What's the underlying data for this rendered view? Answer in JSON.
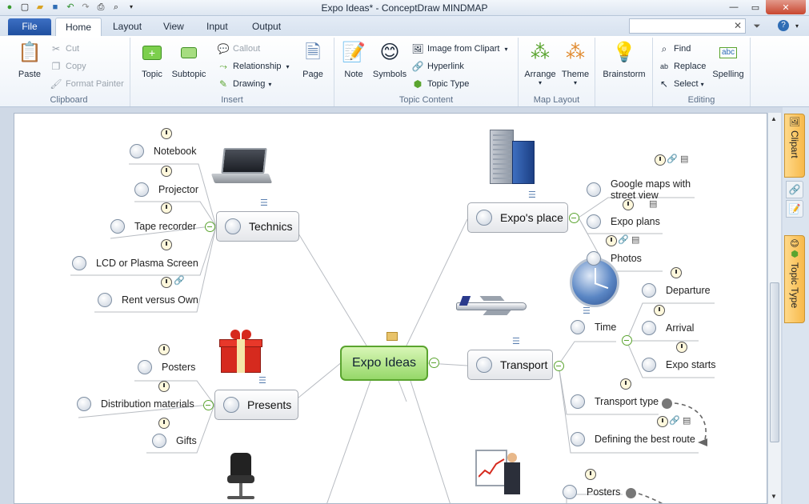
{
  "window": {
    "title": "Expo Ideas* - ConceptDraw MINDMAP"
  },
  "tabs": {
    "file": "File",
    "home": "Home",
    "layout": "Layout",
    "view": "View",
    "input": "Input",
    "output": "Output"
  },
  "ribbon": {
    "clipboard": {
      "label": "Clipboard",
      "paste": "Paste",
      "cut": "Cut",
      "copy": "Copy",
      "format_painter": "Format Painter"
    },
    "insert": {
      "label": "Insert",
      "topic": "Topic",
      "subtopic": "Subtopic",
      "callout": "Callout",
      "relationship": "Relationship",
      "drawing": "Drawing",
      "page": "Page"
    },
    "topic_content": {
      "label": "Topic Content",
      "note": "Note",
      "symbols": "Symbols",
      "image_from_clipart": "Image from Clipart",
      "hyperlink": "Hyperlink",
      "topic_type": "Topic Type"
    },
    "map_layout": {
      "label": "Map Layout",
      "arrange": "Arrange",
      "theme": "Theme"
    },
    "brainstorm": {
      "label": "Brainstorm"
    },
    "editing": {
      "label": "Editing",
      "find": "Find",
      "replace": "Replace",
      "select": "Select",
      "spelling": "Spelling"
    }
  },
  "side_tabs": {
    "clipart": "Clipart",
    "topic_type": "Topic Type"
  },
  "map": {
    "central": "Expo Ideas",
    "technics": {
      "label": "Technics",
      "items": [
        "Notebook",
        "Projector",
        "Tape recorder",
        "LCD or Plasma Screen",
        "Rent versus Own"
      ]
    },
    "presents": {
      "label": "Presents",
      "items": [
        "Posters",
        "Distribution materials",
        "Gifts"
      ]
    },
    "expos_place": {
      "label": "Expo's place",
      "items": [
        "Google maps with",
        "street view",
        "Expo plans",
        "Photos"
      ]
    },
    "transport": {
      "label": "Transport",
      "time": "Time",
      "time_items": [
        "Departure",
        "Arrival",
        "Expo starts"
      ],
      "items": [
        "Transport type",
        "Defining the best route"
      ]
    },
    "bottom_right": {
      "items": [
        "Posters"
      ]
    }
  }
}
